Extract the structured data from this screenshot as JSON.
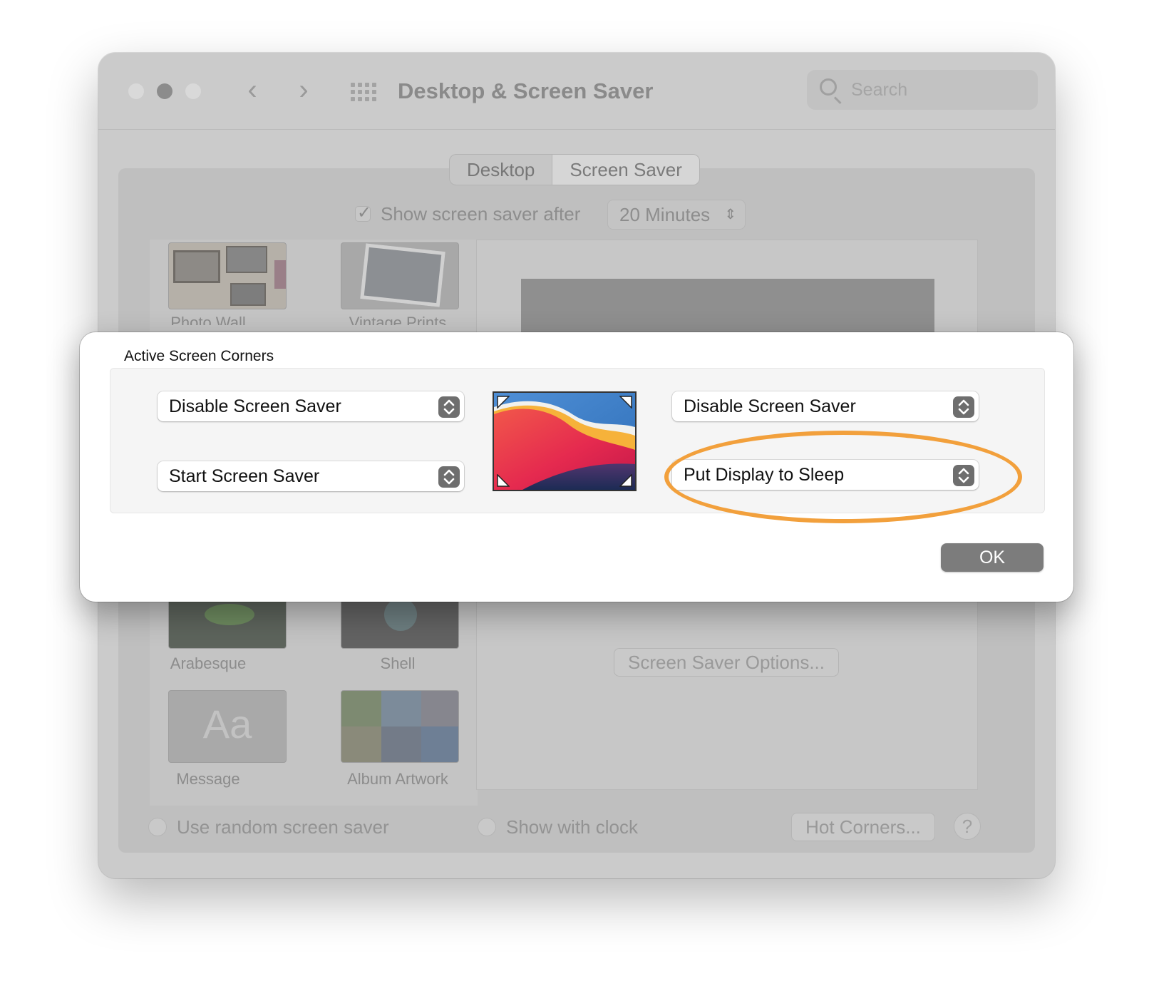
{
  "window": {
    "title": "Desktop & Screen Saver",
    "search_placeholder": "Search",
    "nav_back": "‹",
    "nav_forward": "›"
  },
  "tabs": [
    {
      "label": "Desktop",
      "active": false
    },
    {
      "label": "Screen Saver",
      "active": true
    }
  ],
  "show_after": {
    "label": "Show screen saver after",
    "checked": true,
    "value": "20 Minutes"
  },
  "screensavers": [
    {
      "label": "Photo Wall"
    },
    {
      "label": "Vintage Prints"
    },
    {
      "label": "Arabesque"
    },
    {
      "label": "Shell"
    },
    {
      "label": "Message",
      "glyph": "Aa"
    },
    {
      "label": "Album Artwork"
    }
  ],
  "options_button": "Screen Saver Options...",
  "bottom": {
    "random_label": "Use random screen saver",
    "clock_label": "Show with clock",
    "hot_corners_button": "Hot Corners...",
    "help": "?"
  },
  "sheet": {
    "title": "Active Screen Corners",
    "top_left": "Disable Screen Saver",
    "top_right": "Disable Screen Saver",
    "bottom_left": "Start Screen Saver",
    "bottom_right": "Put Display to Sleep",
    "ok": "OK"
  },
  "colors": {
    "highlight": "#f2a03c",
    "ok_button": "#7c7c7c"
  },
  "icons": {
    "search": "magnifier-icon",
    "grid": "grid-icon",
    "stepper": "up-down-chevron-icon"
  }
}
